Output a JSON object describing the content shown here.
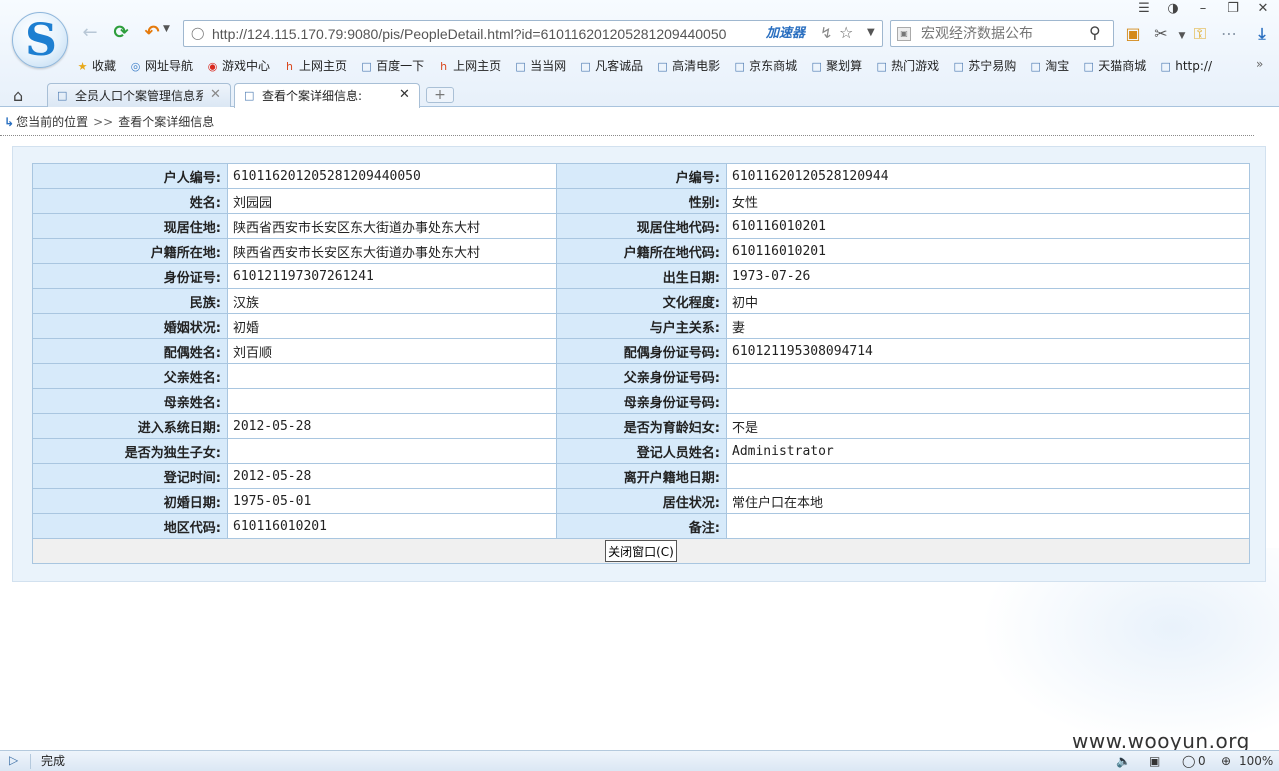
{
  "browser": {
    "address": {
      "url": "http://124.115.170.79:9080/pis/PeopleDetail.html?id=61011620120528120944005­0",
      "accelerator": "加速器"
    },
    "search": {
      "placeholder": "宏观经济数据公布"
    },
    "bookmarks": [
      {
        "label": "收藏",
        "icon": "star-icon"
      },
      {
        "label": "网址导航",
        "icon": "globe-icon"
      },
      {
        "label": "游戏中心",
        "icon": "game-icon"
      },
      {
        "label": "上网主页",
        "icon": "hao-icon"
      },
      {
        "label": "百度一下",
        "icon": "page-icon"
      },
      {
        "label": "上网主页",
        "icon": "hao-icon"
      },
      {
        "label": "当当网",
        "icon": "page-icon"
      },
      {
        "label": "凡客诚品",
        "icon": "page-icon"
      },
      {
        "label": "高清电影",
        "icon": "page-icon"
      },
      {
        "label": "京东商城",
        "icon": "page-icon"
      },
      {
        "label": "聚划算",
        "icon": "page-icon"
      },
      {
        "label": "热门游戏",
        "icon": "page-icon"
      },
      {
        "label": "苏宁易购",
        "icon": "page-icon"
      },
      {
        "label": "淘宝",
        "icon": "page-icon"
      },
      {
        "label": "天猫商城",
        "icon": "page-icon"
      },
      {
        "label": "http://",
        "icon": "page-icon"
      }
    ],
    "tabs": [
      {
        "label": "全员人口个案管理信息系",
        "active": false
      },
      {
        "label": "查看个案详细信息:",
        "active": true
      }
    ]
  },
  "breadcrumb": {
    "location_label": "您当前的位置",
    "separator": ">>",
    "current": "查看个案详细信息"
  },
  "detail": {
    "rows": [
      {
        "l1": "户人编号:",
        "v1": "610116201205281209440050",
        "l2": "户编号:",
        "v2": "61011620120528120944"
      },
      {
        "l1": "姓名:",
        "v1": "刘园园",
        "l2": "性别:",
        "v2": "女性"
      },
      {
        "l1": "现居住地:",
        "v1": "陕西省西安市长安区东大街道办事处东大村",
        "l2": "现居住地代码:",
        "v2": "610116010201"
      },
      {
        "l1": "户籍所在地:",
        "v1": "陕西省西安市长安区东大街道办事处东大村",
        "l2": "户籍所在地代码:",
        "v2": "610116010201"
      },
      {
        "l1": "身份证号:",
        "v1": "610121197307261241",
        "l2": "出生日期:",
        "v2": "1973-07-26"
      },
      {
        "l1": "民族:",
        "v1": "汉族",
        "l2": "文化程度:",
        "v2": "初中"
      },
      {
        "l1": "婚姻状况:",
        "v1": "初婚",
        "l2": "与户主关系:",
        "v2": "妻"
      },
      {
        "l1": "配偶姓名:",
        "v1": "刘百顺",
        "l2": "配偶身份证号码:",
        "v2": "610121195308094714"
      },
      {
        "l1": "父亲姓名:",
        "v1": "",
        "l2": "父亲身份证号码:",
        "v2": ""
      },
      {
        "l1": "母亲姓名:",
        "v1": "",
        "l2": "母亲身份证号码:",
        "v2": ""
      },
      {
        "l1": "进入系统日期:",
        "v1": "2012-05-28",
        "l2": "是否为育龄妇女:",
        "v2": "不是"
      },
      {
        "l1": "是否为独生子女:",
        "v1": "",
        "l2": "登记人员姓名:",
        "v2": "Administrator"
      },
      {
        "l1": "登记时间:",
        "v1": "2012-05-28",
        "l2": "离开户籍地日期:",
        "v2": ""
      },
      {
        "l1": "初婚日期:",
        "v1": "1975-05-01",
        "l2": "居住状况:",
        "v2": "常住户口在本地"
      },
      {
        "l1": "地区代码:",
        "v1": "610116010201",
        "l2": "备注:",
        "v2": ""
      }
    ],
    "close_button": "关闭窗口(C)"
  },
  "status": {
    "text": "完成",
    "count": "0",
    "zoom": "100%"
  },
  "watermark": "www.wooyun.org"
}
